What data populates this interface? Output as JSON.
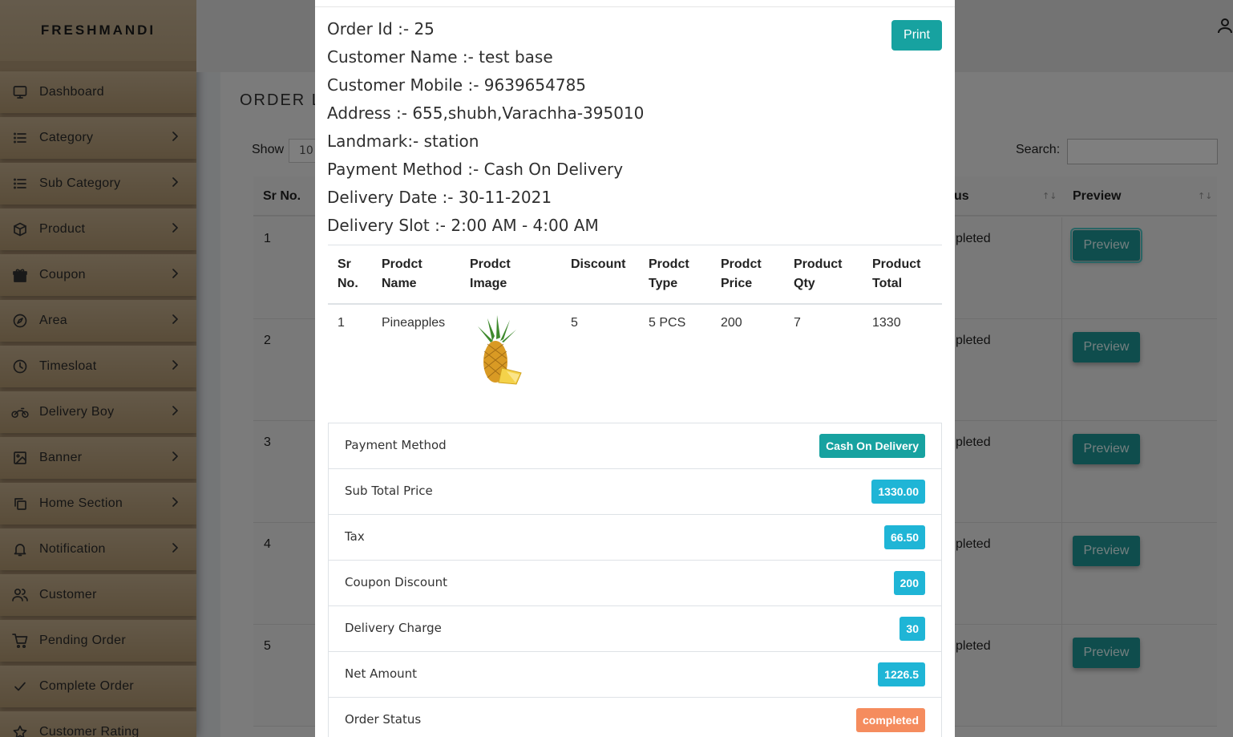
{
  "brand": "FRESHMANDI",
  "sidebar": {
    "items": [
      {
        "label": "Dashboard",
        "icon": "monitor-icon",
        "has_chevron": false
      },
      {
        "label": "Category",
        "icon": "list-icon",
        "has_chevron": true
      },
      {
        "label": "Sub Category",
        "icon": "list-icon",
        "has_chevron": true
      },
      {
        "label": "Product",
        "icon": "box-icon",
        "has_chevron": true
      },
      {
        "label": "Coupon",
        "icon": "gift-icon",
        "has_chevron": true
      },
      {
        "label": "Area",
        "icon": "compass-icon",
        "has_chevron": true
      },
      {
        "label": "Timesloat",
        "icon": "clock-icon",
        "has_chevron": true
      },
      {
        "label": "Delivery Boy",
        "icon": "motorcycle-icon",
        "has_chevron": true
      },
      {
        "label": "Banner",
        "icon": "image-icon",
        "has_chevron": true
      },
      {
        "label": "Home Section",
        "icon": "copy-icon",
        "has_chevron": true
      },
      {
        "label": "Notification",
        "icon": "bell-icon",
        "has_chevron": true
      },
      {
        "label": "Customer",
        "icon": "users-icon",
        "has_chevron": false
      },
      {
        "label": "Pending Order",
        "icon": "cart-icon",
        "has_chevron": false
      },
      {
        "label": "Complete Order",
        "icon": "check-icon",
        "has_chevron": false
      },
      {
        "label": "Customer Rating",
        "icon": "star-icon",
        "has_chevron": false
      }
    ]
  },
  "background": {
    "page_title": "ORDER L",
    "show_label": "Show",
    "show_value": "10",
    "search_label": "Search:",
    "columns": {
      "sr_no": "Sr No.",
      "status": "us",
      "preview": "Preview"
    },
    "rows": [
      {
        "sr": "1",
        "status": "pleted",
        "button": "Preview"
      },
      {
        "sr": "2",
        "status": "pleted",
        "button": "Preview"
      },
      {
        "sr": "3",
        "status": "pleted",
        "button": "Preview"
      },
      {
        "sr": "4",
        "status": "pleted",
        "button": "Preview"
      },
      {
        "sr": "5",
        "status": "pleted",
        "button": "Preview"
      }
    ]
  },
  "modal": {
    "order_id": "Order Id :- 25",
    "customer_name": "Customer Name :- test base",
    "customer_mobile": "Customer Mobile :- 9639654785",
    "address": "Address :- 655,shubh,Varachha-395010",
    "landmark": "Landmark:- station",
    "payment_method": "Payment Method :- Cash On Delivery",
    "delivery_date": "Delivery Date :- 30-11-2021",
    "delivery_slot": "Delivery Slot :- 2:00 AM - 4:00 AM",
    "print_label": "Print",
    "table": {
      "headers": [
        [
          "Sr",
          "No."
        ],
        [
          "Prodct",
          "Name"
        ],
        [
          "Prodct",
          "Image"
        ],
        [
          "Discount",
          ""
        ],
        [
          "Prodct",
          "Type"
        ],
        [
          "Prodct",
          "Price"
        ],
        [
          "Product",
          "Qty"
        ],
        [
          "Product",
          "Total"
        ]
      ],
      "rows": [
        {
          "sr": "1",
          "name": "Pineapples",
          "image": "pineapple-image",
          "discount": "5",
          "type": "5 PCS",
          "price": "200",
          "qty": "7",
          "total": "1330"
        }
      ]
    },
    "summary": [
      {
        "label": "Payment Method",
        "value": "Cash On Delivery",
        "color": "#17a2a0"
      },
      {
        "label": "Sub Total Price",
        "value": "1330.00",
        "color": "#1fb5d6"
      },
      {
        "label": "Tax",
        "value": "66.50",
        "color": "#1fb5d6"
      },
      {
        "label": "Coupon Discount",
        "value": "200",
        "color": "#1fb5d6"
      },
      {
        "label": "Delivery Charge",
        "value": "30",
        "color": "#1fb5d6"
      },
      {
        "label": "Net Amount",
        "value": "1226.5",
        "color": "#1fb5d6"
      },
      {
        "label": "Order Status",
        "value": "completed",
        "color": "#f58c5e"
      }
    ]
  }
}
